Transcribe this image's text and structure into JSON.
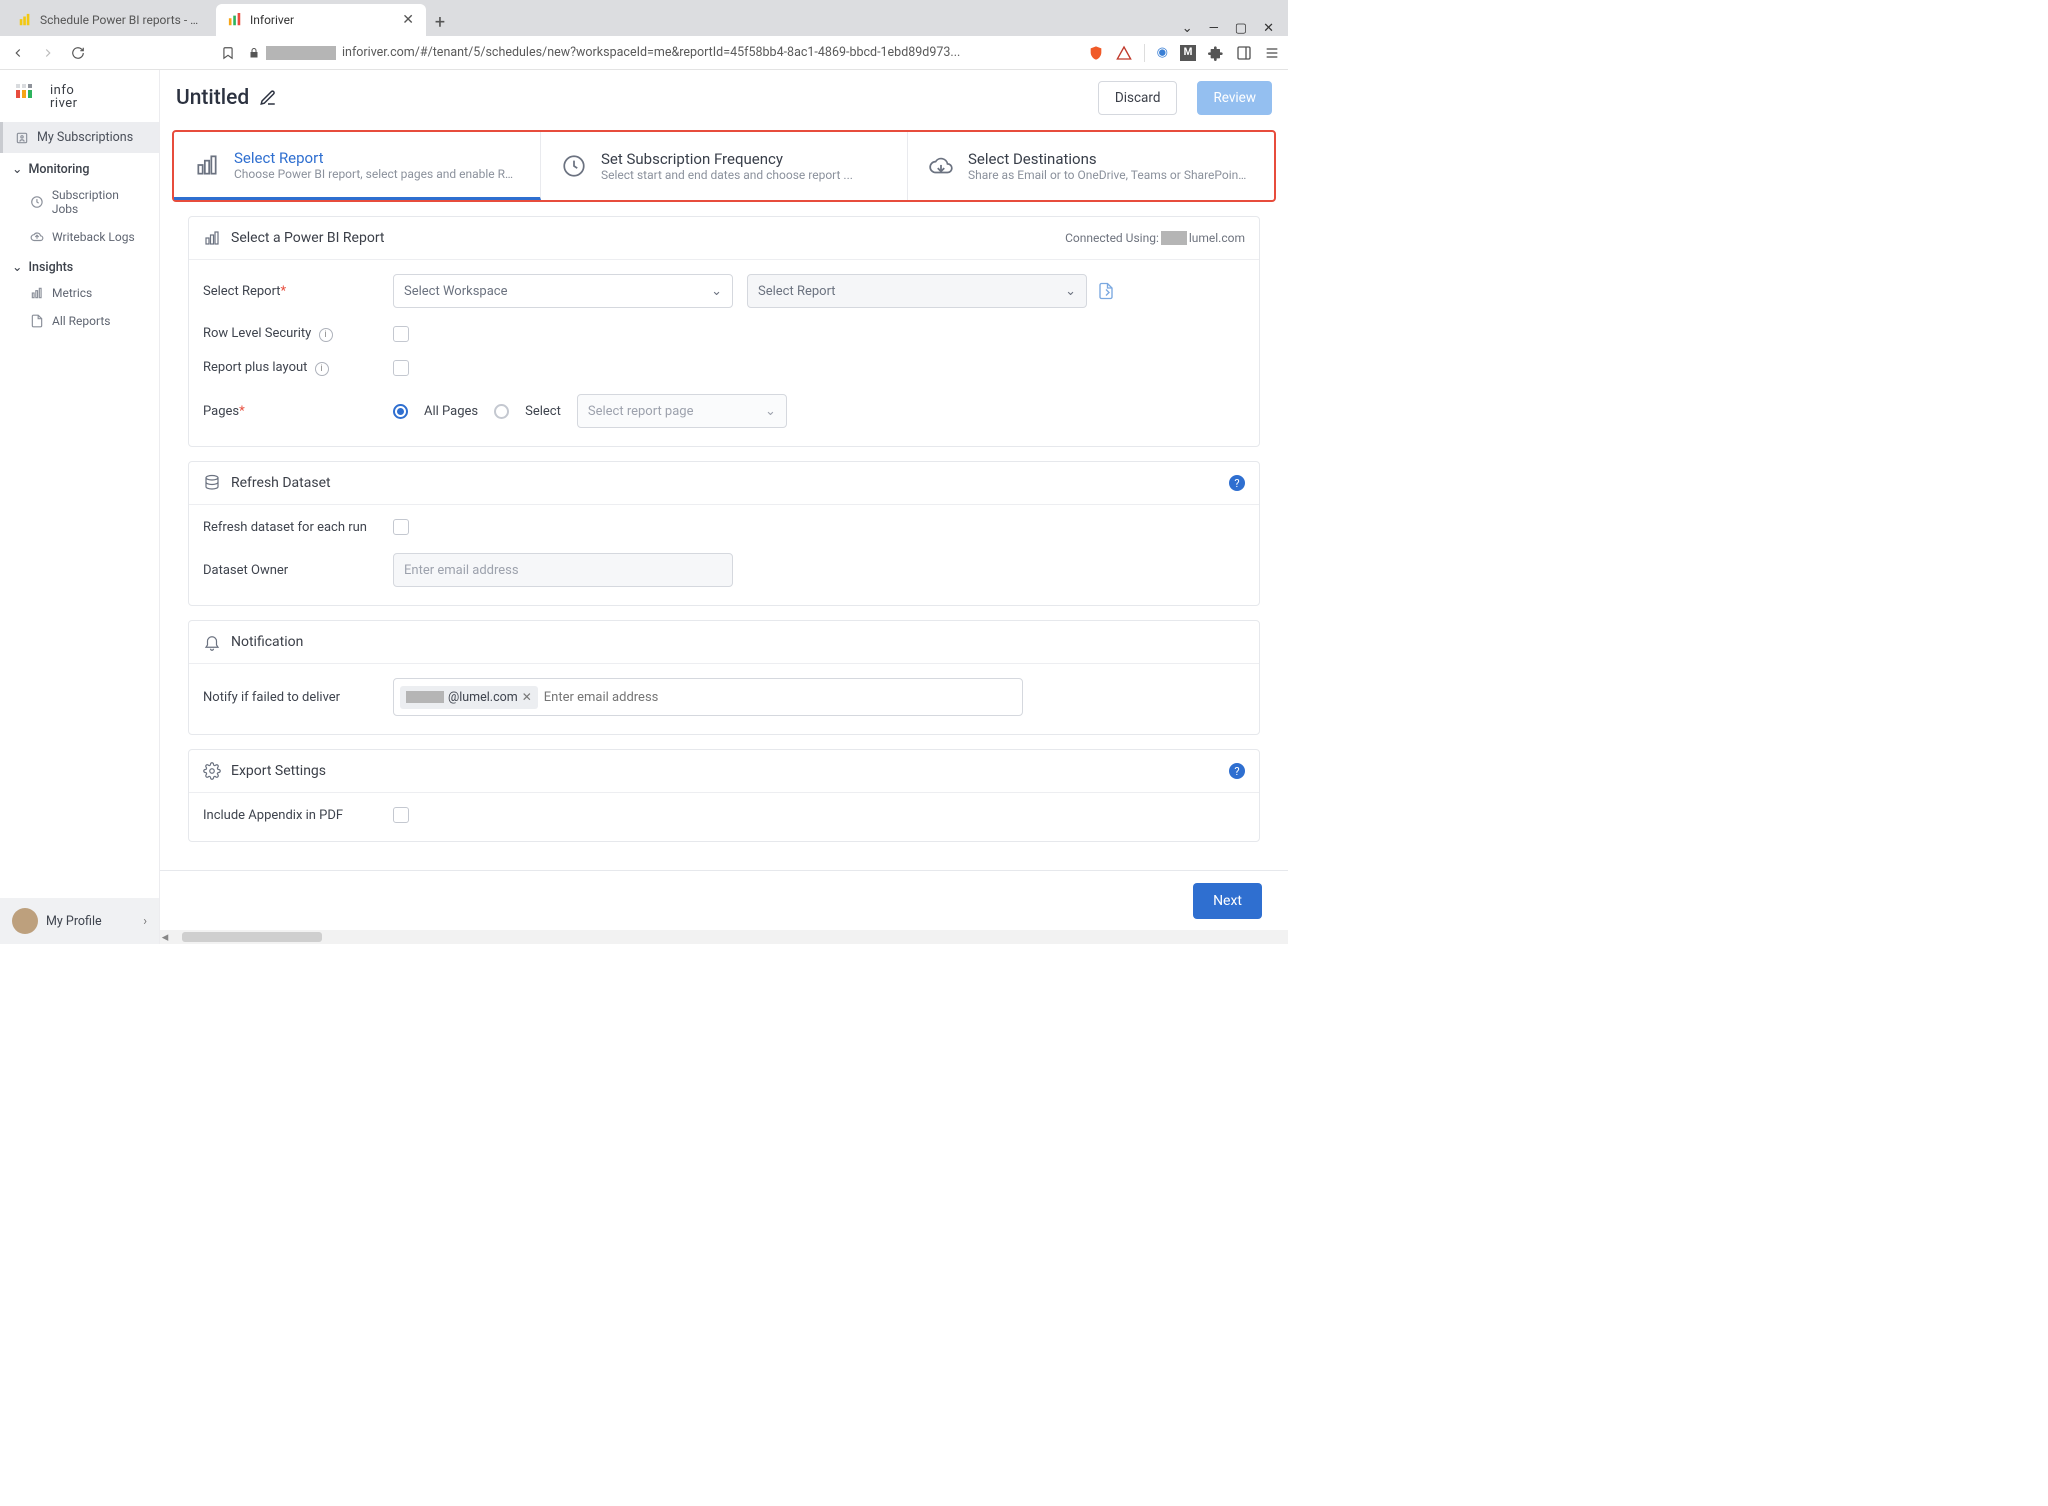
{
  "chrome": {
    "tabs": [
      {
        "label": "Schedule Power BI reports - Power BI"
      },
      {
        "label": "Inforiver"
      }
    ],
    "url_suffix": "inforiver.com/#/tenant/5/schedules/new?workspaceId=me&reportId=45f58bb4-8ac1-4869-bbcd-1ebd89d973..."
  },
  "sidebar": {
    "brand": "info\nriver",
    "my_subs": "My Subscriptions",
    "monitoring": "Monitoring",
    "sub_jobs": "Subscription Jobs",
    "writeback": "Writeback Logs",
    "insights": "Insights",
    "metrics": "Metrics",
    "allreports": "All Reports",
    "profile": "My Profile"
  },
  "header": {
    "title": "Untitled",
    "discard": "Discard",
    "review": "Review"
  },
  "steps": [
    {
      "title": "Select Report",
      "sub": "Choose Power BI report, select pages and enable RL..."
    },
    {
      "title": "Set Subscription Frequency",
      "sub": "Select start and end dates and choose report ..."
    },
    {
      "title": "Select Destinations",
      "sub": "Share as Email or to OneDrive, Teams or SharePoint ..."
    }
  ],
  "report_card": {
    "header": "Select a Power BI Report",
    "connected_label": "Connected Using:",
    "connected_value_suffix": "lumel.com",
    "select_report_label": "Select Report",
    "workspace_placeholder": "Select Workspace",
    "report_placeholder": "Select Report",
    "rls_label": "Row Level Security",
    "layout_label": "Report plus layout",
    "pages_label": "Pages",
    "all_pages": "All Pages",
    "select_pages_option": "Select",
    "page_select_placeholder": "Select report page"
  },
  "refresh_card": {
    "header": "Refresh Dataset",
    "each_run": "Refresh dataset for each run",
    "owner": "Dataset Owner",
    "owner_placeholder": "Enter email address"
  },
  "notif_card": {
    "header": "Notification",
    "fail_label": "Notify if failed to deliver",
    "chip_suffix": "@lumel.com",
    "placeholder": "Enter email address"
  },
  "export_card": {
    "header": "Export Settings",
    "appendix": "Include Appendix in PDF"
  },
  "footer": {
    "next": "Next"
  }
}
